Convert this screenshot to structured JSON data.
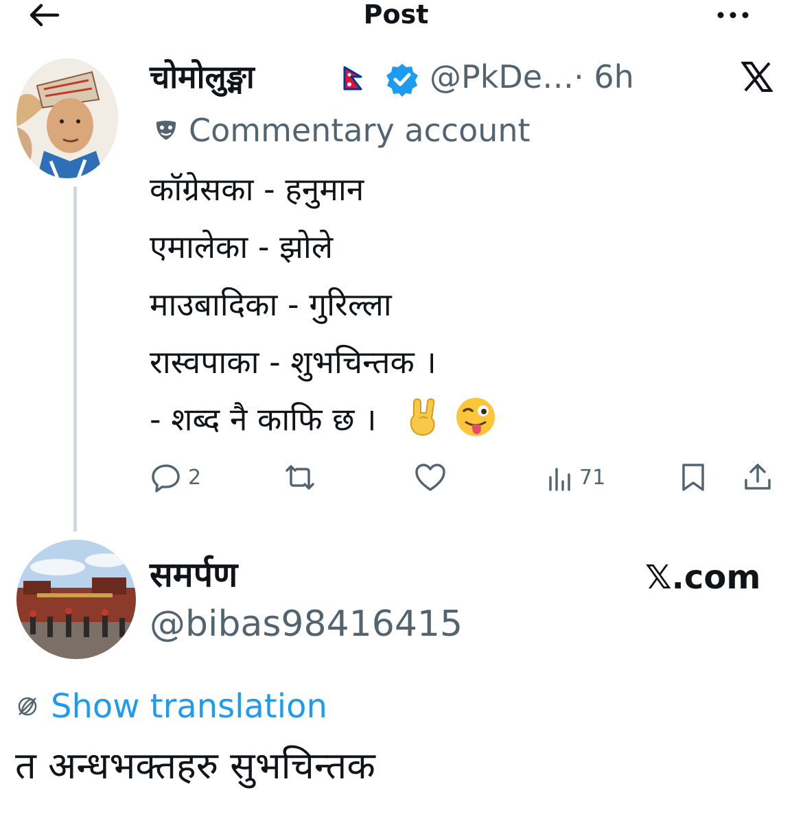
{
  "header": {
    "title": "Post",
    "back_icon": "arrow-left-icon",
    "more_icon": "more-icon"
  },
  "post": {
    "author_name": "चोमोलुङ्मा",
    "flag": "nepal-flag-icon",
    "verified_icon": "verified-badge-icon",
    "verified_color": "#1d9bf0",
    "handle": "@PkDe…",
    "time": "· 6h",
    "platform_icon": "x-logo-icon",
    "commentary_icon": "mask-icon",
    "commentary_label": "Commentary account",
    "lines": [
      "कॉग्रेसका - हनुमान",
      "एमालेका - झोले",
      "माउबादिका - गुरिल्ला",
      "रास्वपाका - शुभचिन्तक ।",
      "- शब्द नै काफि छ ।"
    ],
    "emojis": [
      "rock-on-hand-emoji",
      "winking-tongue-emoji"
    ],
    "actions": {
      "reply_count": "2",
      "retweet_count": "",
      "like_count": "",
      "views_count": "71"
    }
  },
  "reply": {
    "author_name": "समर्पण",
    "handle": "@bibas98416415",
    "watermark": "𝕏.com",
    "translate_icon": "globe-icon",
    "show_translation": "Show translation",
    "text": "त अन्धभक्तहरु सुभचिन्तक"
  },
  "colors": {
    "secondary_text": "#536471",
    "link": "#1d9bf0",
    "thread_line": "#cfd9de"
  }
}
